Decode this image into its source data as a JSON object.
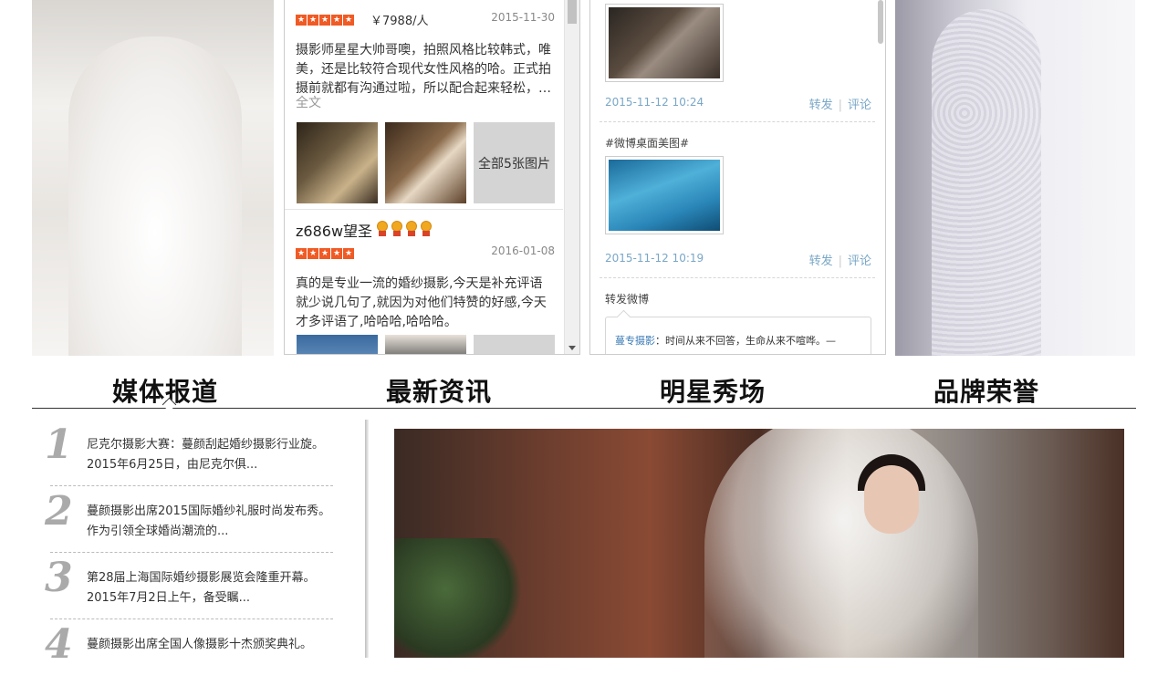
{
  "reviews": {
    "review1": {
      "price": "￥7988/人",
      "date": "2015-11-30",
      "text": "摄影师星星大帅哥噢，拍照风格比较韩式，唯美，还是比较符合现代女性风格的哈。正式拍摄前就都有沟通过啦，所以配合起来轻松，…",
      "fulltext_label": "全文",
      "more_photos_label": "全部5张图片"
    },
    "review2": {
      "username": "z686w望圣",
      "date": "2016-01-08",
      "text": "真的是专业一流的婚纱摄影,今天是补充评语就少说几句了,就因为对他们特赞的好感,今天才多评语了,哈哈哈,哈哈哈。"
    },
    "star_glyph": "★"
  },
  "weibo": {
    "post1": {
      "time": "2015-11-12 10:24",
      "forward": "转发",
      "comment": "评论"
    },
    "post2": {
      "topic": "#微博桌面美图#",
      "time": "2015-11-12 10:19",
      "forward": "转发",
      "comment": "评论"
    },
    "post3": {
      "label": "转发微博",
      "quote_nick": "蔓专摄影",
      "quote_text": "：时间从来不回答，生命从来不喧哗。—"
    },
    "separator": "|"
  },
  "nav": {
    "tabs": [
      "媒体报道",
      "最新资讯",
      "明星秀场",
      "品牌荣誉"
    ]
  },
  "news": {
    "items": [
      {
        "num": "1",
        "title": "尼克尔摄影大赛：蔓颜刮起婚纱摄影行业旋。2015年6月25日，由尼克尔俱..."
      },
      {
        "num": "2",
        "title": "蔓颜摄影出席2015国际婚纱礼服时尚发布秀。作为引领全球婚尚潮流的..."
      },
      {
        "num": "3",
        "title": "第28届上海国际婚纱摄影展览会隆重开幕。2015年7月2日上午，备受瞩..."
      },
      {
        "num": "4",
        "title": "蔓颜摄影出席全国人像摄影十杰颁奖典礼。"
      }
    ]
  },
  "colors": {
    "star": "#f05a24",
    "link": "#7aa7c7",
    "nav_text": "#111111"
  }
}
